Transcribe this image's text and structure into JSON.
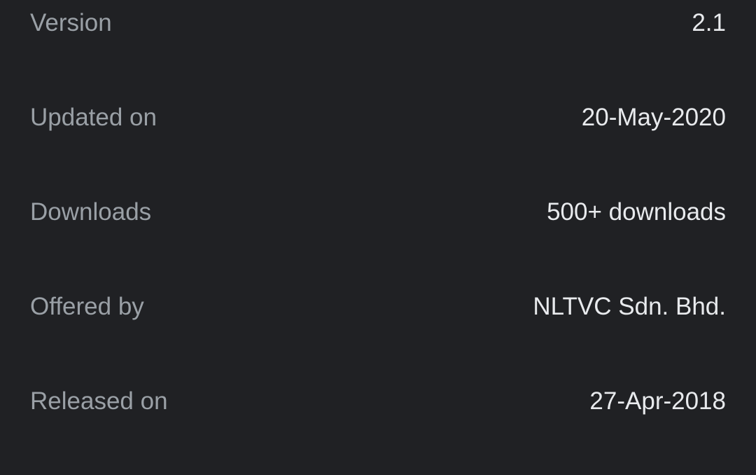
{
  "app_info": {
    "rows": [
      {
        "label": "Version",
        "value": "2.1"
      },
      {
        "label": "Updated on",
        "value": "20-May-2020"
      },
      {
        "label": "Downloads",
        "value": "500+ downloads"
      },
      {
        "label": "Offered by",
        "value": "NLTVC Sdn. Bhd."
      },
      {
        "label": "Released on",
        "value": "27-Apr-2018"
      }
    ]
  },
  "colors": {
    "background": "#202124",
    "label": "#9aa0a6",
    "value": "#e8eaed"
  }
}
